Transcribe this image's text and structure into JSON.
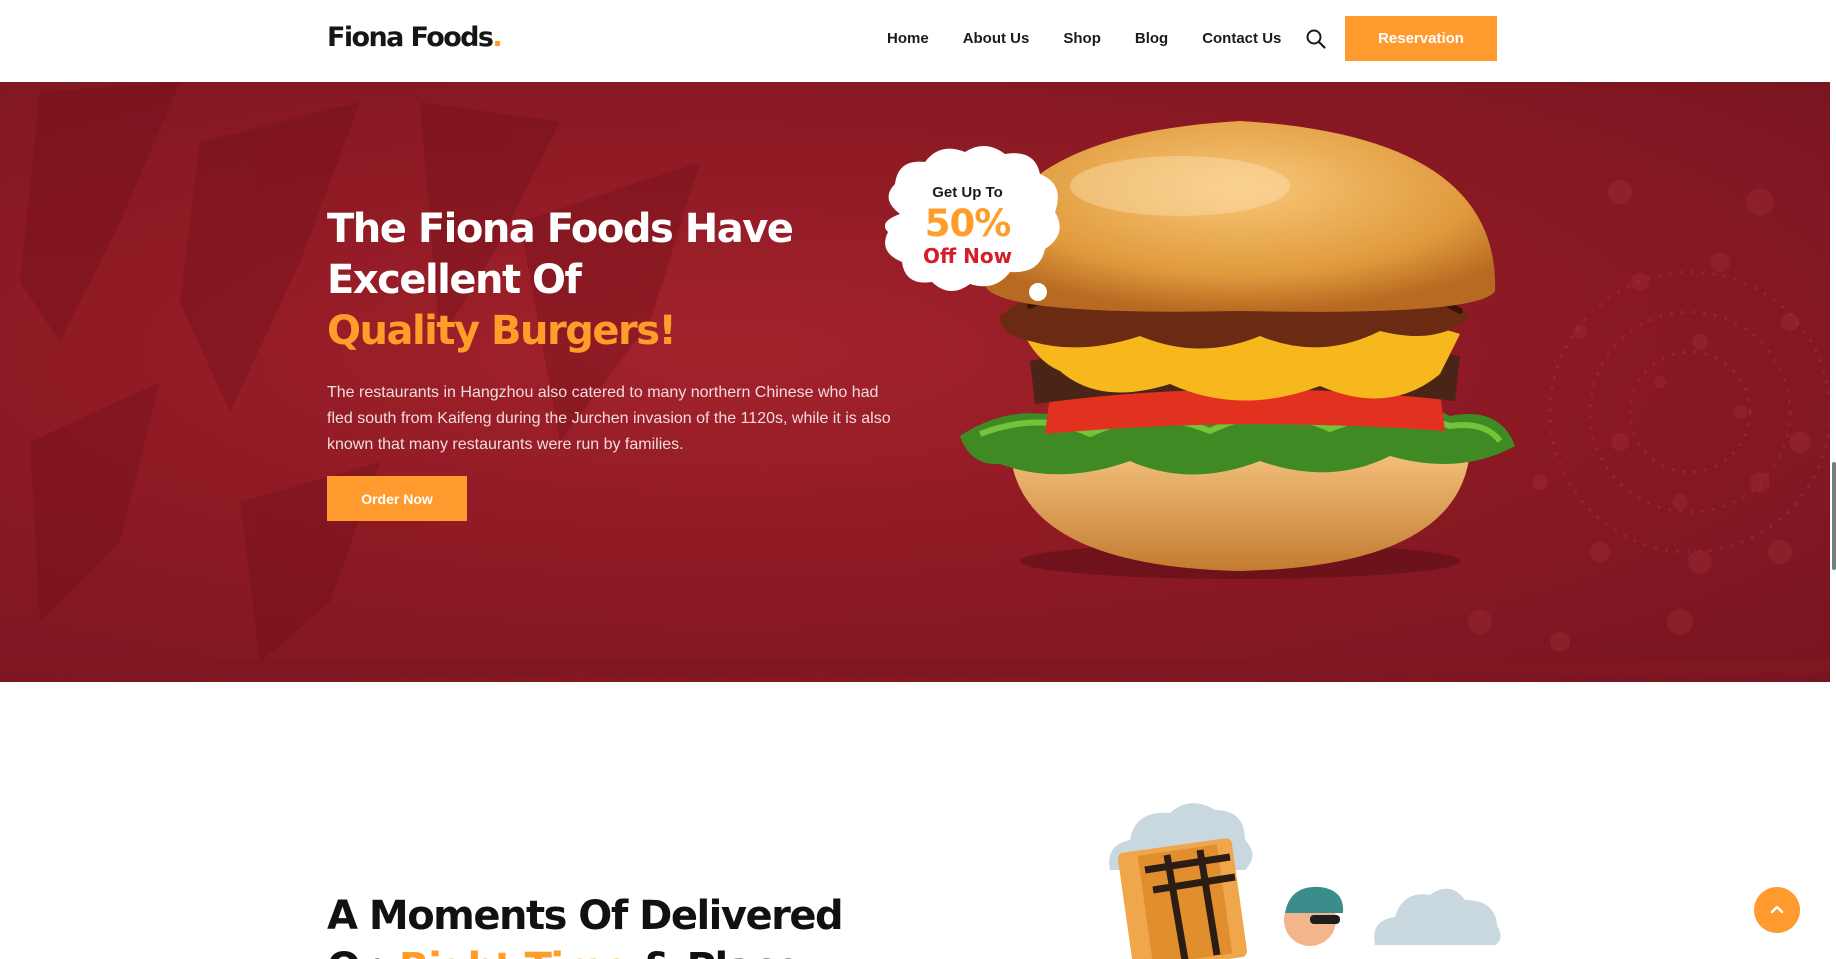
{
  "header": {
    "logo": {
      "text": "Fiona Foods",
      "dot": "."
    },
    "nav": [
      "Home",
      "About Us",
      "Shop",
      "Blog",
      "Contact Us"
    ],
    "search_icon": "search-icon",
    "reservation_label": "Reservation"
  },
  "hero": {
    "title_line1": "The Fiona Foods Have",
    "title_line2": "Excellent Of",
    "title_accent": "Quality Burgers!",
    "description": "The restaurants in Hangzhou also catered to many northern Chinese who had fled south from Kaifeng during the Jurchen invasion of the 1120s, while it is also known that many restaurants were run by families.",
    "order_label": "Order Now",
    "badge": {
      "line1": "Get Up To",
      "percent": "50%",
      "line2": "Off Now"
    }
  },
  "delivery": {
    "title_line1": "A Moments Of Delivered",
    "title_line2_start": "On ",
    "title_line2_accent": "Right Time",
    "title_line2_end": " & Place"
  },
  "scroll_top_icon": "chevron-up-icon",
  "colors": {
    "accent": "#ff9b2e",
    "hero_red": "#8e1a24",
    "badge_red": "#d21f2b",
    "text_dark": "#111111"
  }
}
